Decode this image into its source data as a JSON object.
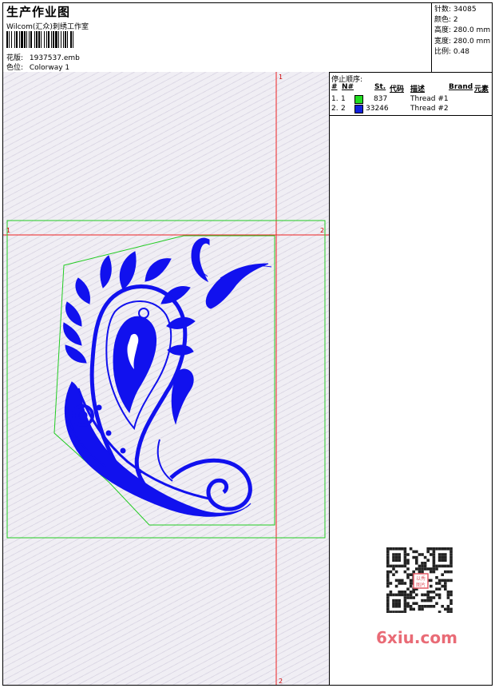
{
  "header": {
    "title": "生产作业图",
    "company": "Wilcom(汇众)刺绣工作室",
    "design_label": "花版:",
    "design_value": "1937537.emb",
    "colorway_label": "色位:",
    "colorway_value": "Colorway 1"
  },
  "stats": {
    "stitches_label": "针数:",
    "stitches_value": "34085",
    "colors_label": "颜色:",
    "colors_value": "2",
    "height_label": "高度:",
    "height_value": "280.0 mm",
    "width_label": "宽度:",
    "width_value": "280.0 mm",
    "scale_label": "比例:",
    "scale_value": "0.48"
  },
  "stop_sequence": {
    "title": "停止顺序:",
    "columns": [
      "#",
      "N#",
      "St.",
      "代码",
      "描述",
      "Brand",
      "元素"
    ],
    "rows": [
      {
        "index": "1.",
        "needle": "1",
        "color": "#22dd22",
        "code": "837",
        "desc": "Thread #1"
      },
      {
        "index": "2.",
        "needle": "2",
        "color": "#1122dd",
        "code": "33246",
        "desc": "Thread #2"
      }
    ]
  },
  "canvas": {
    "vertical_top_label": "1",
    "vertical_bottom_label": "2",
    "horizontal_left_label": "1",
    "horizontal_right_label": "2",
    "guide_color": "#ee2222",
    "outline_color": "#22cc22",
    "design_color": "#1111ee"
  },
  "watermark": {
    "text": "6xiu.com",
    "seal": "以秀图片"
  }
}
